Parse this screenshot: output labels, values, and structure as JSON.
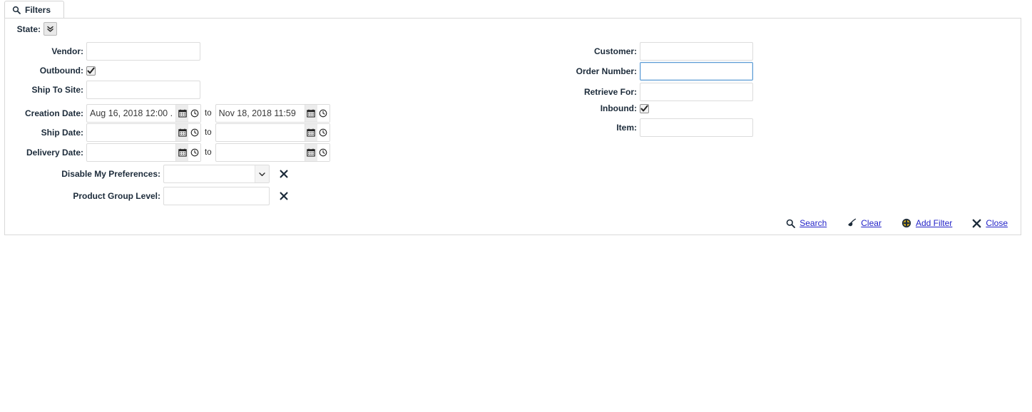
{
  "tab": {
    "label": "Filters",
    "icon": "search-icon"
  },
  "left_column": {
    "state": {
      "label": "State:",
      "button_icon": "double-chevron-down-icon"
    },
    "vendor": {
      "label": "Vendor:",
      "value": "",
      "placeholder": ""
    },
    "outbound": {
      "label": "Outbound:",
      "checked": true
    },
    "ship_to_site": {
      "label": "Ship To Site:",
      "value": "",
      "placeholder": ""
    },
    "creation_date": {
      "label": "Creation Date:",
      "from": "Aug 16, 2018 12:00 .",
      "to_label": "to",
      "to": "Nov 18, 2018 11:59",
      "calendar_icon": "calendar-icon",
      "clock_icon": "clock-icon"
    },
    "ship_date": {
      "label": "Ship Date:",
      "from": "",
      "to_label": "to",
      "to": ""
    },
    "delivery_date": {
      "label": "Delivery Date:",
      "from": "",
      "to_label": "to",
      "to": ""
    },
    "disable_my_preferences": {
      "label": "Disable My Preferences:",
      "value": "",
      "options": [
        ""
      ],
      "remove_icon": "close-x-icon"
    },
    "product_group_level": {
      "label": "Product Group Level:",
      "value": "",
      "placeholder": "",
      "remove_icon": "close-x-icon"
    }
  },
  "right_column": {
    "customer": {
      "label": "Customer:",
      "value": "",
      "placeholder": ""
    },
    "order_number": {
      "label": "Order Number:",
      "value": "",
      "placeholder": "",
      "focused": true
    },
    "retrieve_for": {
      "label": "Retrieve For:",
      "value": "",
      "placeholder": ""
    },
    "inbound": {
      "label": "Inbound:",
      "checked": true
    },
    "item": {
      "label": "Item:",
      "value": "",
      "placeholder": ""
    }
  },
  "actions": [
    {
      "label": "Search",
      "icon": "search-icon"
    },
    {
      "label": "Clear",
      "icon": "eraser-icon"
    },
    {
      "label": "Add Filter",
      "icon": "plus-circle-icon"
    },
    {
      "label": "Close",
      "icon": "close-x-icon"
    }
  ],
  "colors": {
    "link": "#2323c8",
    "panel_border": "#d9d9d9",
    "field_border": "#dcdcdc",
    "focus_border": "#5b9bd5",
    "text": "#1c2b3a"
  }
}
